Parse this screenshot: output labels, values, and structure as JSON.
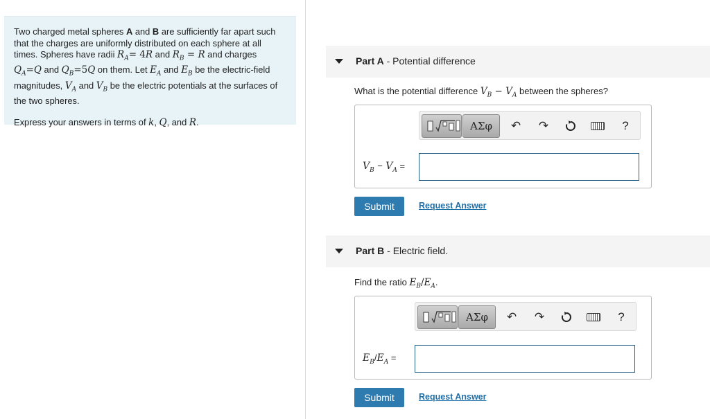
{
  "problem": {
    "p1_a": "Two charged metal spheres ",
    "p1_A": "A",
    "p1_and": " and ",
    "p1_B": "B",
    "p1_b": " are sufficiently far apart such that the charges are uniformly distributed on each sphere at all times. Spheres have radii ",
    "p1_c": " and ",
    "p1_d": " and charges ",
    "p1_e": " and ",
    "p1_f": " on them. Let ",
    "p1_g": " and ",
    "p1_h": " be the electric-field magnitudes, ",
    "p1_i": " and ",
    "p1_j": " be the electric potentials  at the surfaces of the two spheres.",
    "p2_a": "Express your answers in terms of ",
    "p2_b": ", ",
    "p2_c": ", and ",
    "p2_d": "."
  },
  "partA": {
    "part_label": "Part A",
    "title_sep": " - ",
    "title": "Potential difference",
    "question_a": "What is the potential difference ",
    "question_b": " between the spheres?",
    "equation_suffix": " =",
    "input_value": "",
    "submit_label": "Submit",
    "request_label": "Request Answer"
  },
  "partB": {
    "part_label": "Part B",
    "title_sep": " - ",
    "title": "Electric field.",
    "question_a": "Find the ratio ",
    "question_b": ".",
    "equation_suffix": " =",
    "input_value": "",
    "submit_label": "Submit",
    "request_label": "Request Answer"
  },
  "toolbar": {
    "greek_label": "ΑΣφ",
    "help_label": "?"
  }
}
